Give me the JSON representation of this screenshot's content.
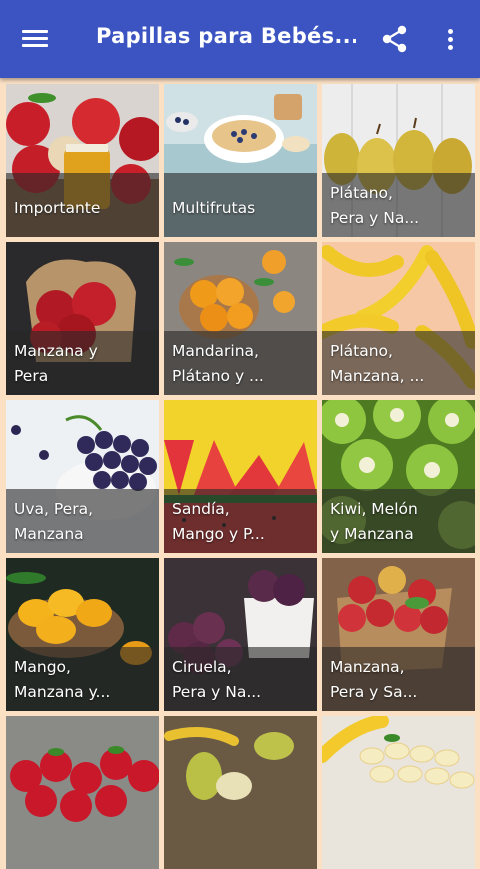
{
  "appbar": {
    "title": "Papillas para Bebés...",
    "menu_icon": "hamburger-menu-icon",
    "share_icon": "share-icon",
    "more_icon": "more-vertical-icon",
    "color": "#3b54c2"
  },
  "tiles": [
    {
      "label": "Importante",
      "image": "apples-and-puree-jar"
    },
    {
      "label": "Multifrutas",
      "image": "blueberry-oatmeal-bowl"
    },
    {
      "label": "Plátano,\nPera y Na...",
      "image": "pears"
    },
    {
      "label": "Manzana y\nPera",
      "image": "red-apples-sack"
    },
    {
      "label": "Mandarina,\nPlátano y ...",
      "image": "mandarins"
    },
    {
      "label": "Plátano,\nManzana, ...",
      "image": "bananas"
    },
    {
      "label": "Uva, Pera,\nManzana",
      "image": "grapes"
    },
    {
      "label": "Sandía,\nMango y P...",
      "image": "watermelon-slices"
    },
    {
      "label": "Kiwi, Melón\ny Manzana",
      "image": "kiwi-slices"
    },
    {
      "label": "Mango,\nManzana y...",
      "image": "mangoes"
    },
    {
      "label": "Ciruela,\nPera y Na...",
      "image": "plums"
    },
    {
      "label": "Manzana,\nPera y Sa...",
      "image": "apples-basket"
    },
    {
      "label": "",
      "image": "strawberries"
    },
    {
      "label": "",
      "image": "pears-and-bananas"
    },
    {
      "label": "",
      "image": "banana-slices"
    }
  ],
  "colors": {
    "background": "#fbe0c4",
    "label_band": "rgba(40,40,40,0.60)"
  }
}
